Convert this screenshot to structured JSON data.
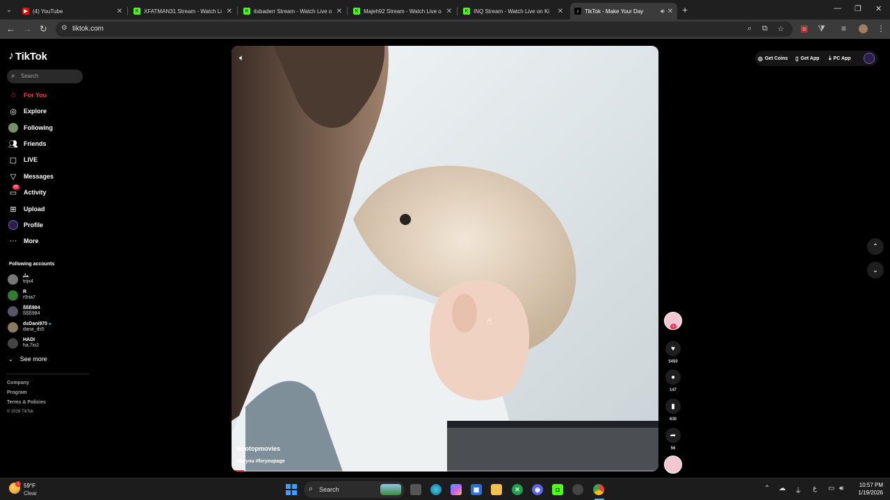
{
  "browser": {
    "tabs": [
      {
        "title": "(4) YouTube",
        "favicon_color": "#ff0000",
        "favicon_glyph": "▶"
      },
      {
        "title": "XFATMAN31 Stream - Watch Li",
        "favicon_color": "#53fc18",
        "favicon_glyph": "K"
      },
      {
        "title": "itsbaderr Stream - Watch Live o",
        "favicon_color": "#53fc18",
        "favicon_glyph": "K"
      },
      {
        "title": "Majeh92 Stream - Watch Live o",
        "favicon_color": "#53fc18",
        "favicon_glyph": "K"
      },
      {
        "title": "INQ Stream - Watch Live on Ki",
        "favicon_color": "#53fc18",
        "favicon_glyph": "K"
      },
      {
        "title": "TikTok - Make Your Day",
        "favicon_color": "#000000",
        "favicon_glyph": "♪"
      }
    ],
    "url": "tiktok.com"
  },
  "sidebar": {
    "logo": "TikTok",
    "search_placeholder": "Search",
    "nav": [
      {
        "label": "For You",
        "icon": "home-icon"
      },
      {
        "label": "Explore",
        "icon": "compass-icon"
      },
      {
        "label": "Following",
        "icon": "following-avatar-icon"
      },
      {
        "label": "Friends",
        "icon": "friends-icon"
      },
      {
        "label": "LIVE",
        "icon": "live-icon"
      },
      {
        "label": "Messages",
        "icon": "messages-icon"
      },
      {
        "label": "Activity",
        "icon": "activity-icon",
        "badge": "23"
      },
      {
        "label": "Upload",
        "icon": "upload-icon"
      },
      {
        "label": "Profile",
        "icon": "profile-avatar-icon"
      },
      {
        "label": "More",
        "icon": "more-icon"
      }
    ],
    "following_title": "Following accounts",
    "following": [
      {
        "name": "ﻪﻠﺑ",
        "username": "trijx4",
        "color": "#777777"
      },
      {
        "name": "R",
        "username": "r0ria7",
        "color": "#2e7d32"
      },
      {
        "name": "ßßß984",
        "username": "ßßß984",
        "color": "#555566"
      },
      {
        "name": "dsDani970",
        "username": "dana_ds5",
        "color": "#8a7a60"
      },
      {
        "name": "HADI",
        "username": "ha.7io2",
        "color": "#444444"
      }
    ],
    "see_more": "See more",
    "footer": [
      "Company",
      "Program",
      "Terms & Policies"
    ],
    "copyright": "© 2026 TikTok"
  },
  "topbar": {
    "get_coins": "Get Coins",
    "get_app": "Get App",
    "pc_app": "PC App"
  },
  "video": {
    "author": "wootopmovies",
    "tags": "#foryou #foryoupage",
    "progress": 0.03
  },
  "actions": {
    "likes": "5450",
    "comments": "147",
    "saves": "630",
    "shares": "56"
  },
  "taskbar": {
    "temp": "59°F",
    "condition": "Clear",
    "search": "Search",
    "time": "10:57 PM",
    "date": "1/19/2026"
  },
  "colors": {
    "accent": "#fe2c55",
    "kick": "#53fc18"
  }
}
